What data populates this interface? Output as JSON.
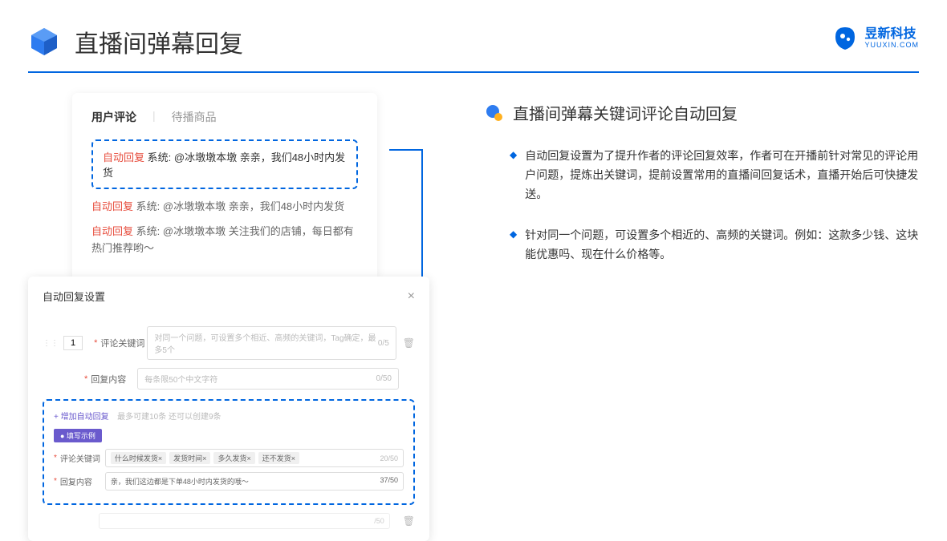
{
  "header": {
    "title": "直播间弹幕回复"
  },
  "brand": {
    "cn": "昱新科技",
    "en": "YUUXIN.COM"
  },
  "commentCard": {
    "tab1": "用户评论",
    "tab2": "待播商品",
    "highlight": {
      "label": "自动回复",
      "sys": "系统:",
      "text": "@冰墩墩本墩 亲亲，我们48小时内发货"
    },
    "item2": {
      "label": "自动回复",
      "sys": "系统:",
      "text": "@冰墩墩本墩 亲亲，我们48小时内发货"
    },
    "item3": {
      "label": "自动回复",
      "sys": "系统:",
      "text": "@冰墩墩本墩 关注我们的店铺，每日都有热门推荐哟～"
    }
  },
  "settings": {
    "title": "自动回复设置",
    "num": "1",
    "keywordLabel": "评论关键词",
    "keywordPlaceholder": "对同一个问题，可设置多个相近、高频的关键词，Tag确定，最多5个",
    "keywordCounter": "0/5",
    "contentLabel": "回复内容",
    "contentPlaceholder": "每条限50个中文字符",
    "contentCounter": "0/50",
    "addLink": "+ 增加自动回复",
    "addHint": "最多可建10条 还可以创建9条",
    "exampleBadge": "● 填写示例",
    "exKeywordLabel": "评论关键词",
    "tags": [
      "什么时候发货×",
      "发货时间×",
      "多久发货×",
      "还不发货×"
    ],
    "tagCounter": "20/50",
    "exContentLabel": "回复内容",
    "exContentText": "亲，我们这边都是下单48小时内发货的哦～",
    "exContentCounter": "37/50",
    "ghostCounter": "/50"
  },
  "right": {
    "sectionTitle": "直播间弹幕关键词评论自动回复",
    "bullet1": "自动回复设置为了提升作者的评论回复效率，作者可在开播前针对常见的评论用户问题，提炼出关键词，提前设置常用的直播间回复话术，直播开始后可快捷发送。",
    "bullet2": "针对同一个问题，可设置多个相近的、高频的关键词。例如：这款多少钱、这块能优惠吗、现在什么价格等。"
  }
}
